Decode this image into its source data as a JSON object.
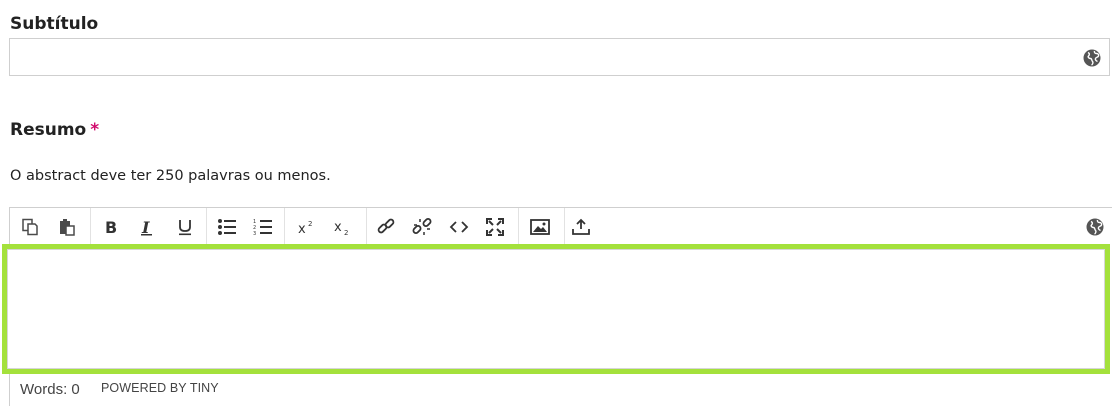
{
  "subtitle": {
    "label": "Subtítulo",
    "value": "",
    "language_icon": "globe-icon"
  },
  "abstract": {
    "label": "Resumo",
    "required_marker": "*",
    "description": "O abstract deve ter 250 palavras ou menos.",
    "content": ""
  },
  "toolbar": {
    "buttons": [
      "copy-icon",
      "paste-icon",
      "bold-icon",
      "italic-icon",
      "underline-icon",
      "bullet-list-icon",
      "numbered-list-icon",
      "superscript-icon",
      "subscript-icon",
      "link-icon",
      "unlink-icon",
      "code-icon",
      "fullscreen-icon",
      "image-icon",
      "upload-icon"
    ],
    "language_icon": "globe-icon"
  },
  "status": {
    "words": "Words: 0",
    "powered": "POWERED BY TINY"
  },
  "colors": {
    "focus_outline": "#a4e13c",
    "required": "#d00a6c",
    "icon": "#4a4a4a"
  }
}
